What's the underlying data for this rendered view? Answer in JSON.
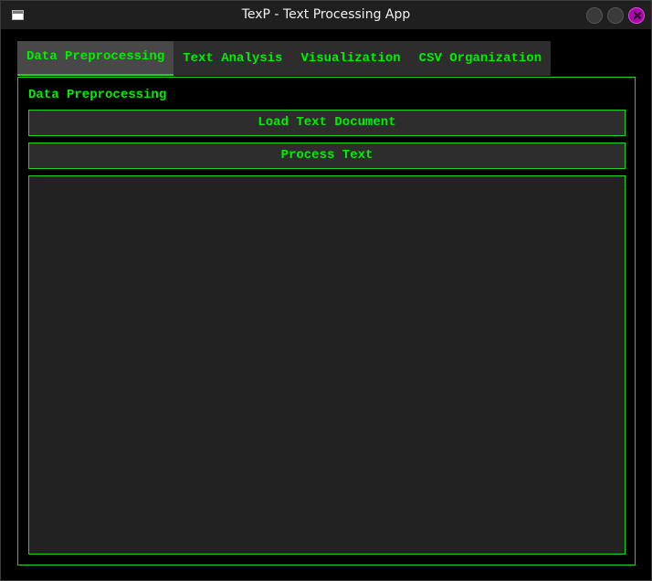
{
  "window": {
    "title": "TexP - Text Processing App"
  },
  "tabs": [
    {
      "label": "Data Preprocessing",
      "active": true
    },
    {
      "label": "Text Analysis",
      "active": false
    },
    {
      "label": "Visualization",
      "active": false
    },
    {
      "label": "CSV Organization",
      "active": false
    }
  ],
  "panel": {
    "title": "Data Preprocessing",
    "load_label": "Load Text Document",
    "process_label": "Process Text",
    "output_text": ""
  },
  "colors": {
    "accent": "#00ee00",
    "background": "#000000",
    "control_bg": "#2d2d2d",
    "close_button": "#b000b0"
  }
}
